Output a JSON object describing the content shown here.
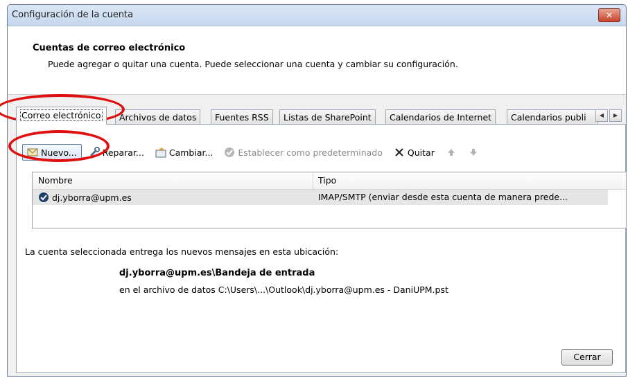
{
  "window": {
    "title": "Configuración de la cuenta",
    "close_label": "✕"
  },
  "header": {
    "title": "Cuentas de correo electrónico",
    "description": "Puede agregar o quitar una cuenta. Puede seleccionar una cuenta y cambiar su configuración."
  },
  "tabs": [
    {
      "label": "Correo electrónico",
      "active": true
    },
    {
      "label": "Archivos de datos"
    },
    {
      "label": "Fuentes RSS"
    },
    {
      "label": "Listas de SharePoint"
    },
    {
      "label": "Calendarios de Internet"
    },
    {
      "label": "Calendarios publi"
    }
  ],
  "toolbar": {
    "new_label": "Nuevo...",
    "repair_label": "Reparar...",
    "change_label": "Cambiar...",
    "default_label": "Establecer como predeterminado",
    "remove_label": "Quitar"
  },
  "list": {
    "columns": [
      "Nombre",
      "Tipo"
    ],
    "rows": [
      {
        "name": "dj.yborra@upm.es",
        "type": "IMAP/SMTP (enviar desde esta cuenta de manera prede..."
      }
    ]
  },
  "info": {
    "line1": "La cuenta seleccionada entrega los nuevos mensajes en esta ubicación:",
    "location": "dj.yborra@upm.es\\Bandeja de entrada",
    "file": "en el archivo de datos C:\\Users\\...\\Outlook\\dj.yborra@upm.es - DaniUPM.pst"
  },
  "footer": {
    "close_label": "Cerrar"
  },
  "colors": {
    "annotation": "#e11010",
    "title_gradient_top": "#dbe7f6",
    "close_button": "#c7442b"
  }
}
